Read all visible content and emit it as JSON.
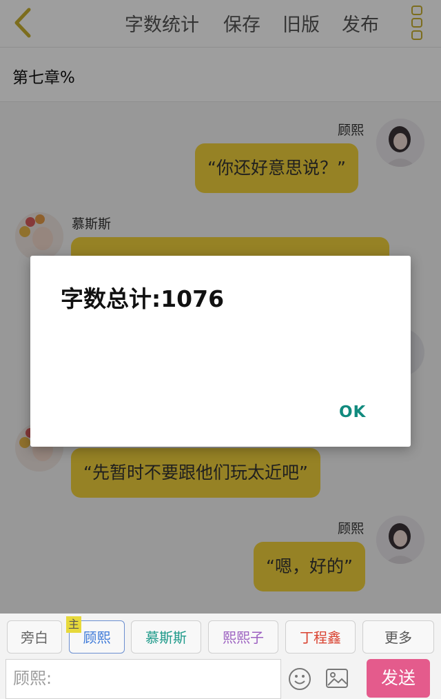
{
  "toolbar": {
    "back_icon": "chevron-left-icon",
    "word_count": "字数统计",
    "save": "保存",
    "old_version": "旧版",
    "publish": "发布",
    "more_icon": "more-vertical-icon",
    "accent_color": "#c9b030"
  },
  "chapter": {
    "title": "第七章%"
  },
  "messages": [
    {
      "speaker": "顾熙",
      "side": "right",
      "text": "“你还好意思说？”"
    },
    {
      "speaker": "慕斯斯",
      "side": "left",
      "text": ""
    },
    {
      "speaker": "",
      "side": "left",
      "text": "“先暂时不要跟他们玩太近吧”"
    },
    {
      "speaker": "顾熙",
      "side": "right",
      "text": "“嗯，好的”"
    }
  ],
  "bubble_color": "#f3d23c",
  "dialog": {
    "message": "字数总计:1076",
    "ok": "OK",
    "ok_color": "#118a7e"
  },
  "characters": {
    "main_tag": "主",
    "items": [
      {
        "label": "旁白",
        "color": "#666666"
      },
      {
        "label": "顾熙",
        "color": "#3b78d8"
      },
      {
        "label": "慕斯斯",
        "color": "#1f9a8a"
      },
      {
        "label": "熙熙子",
        "color": "#9b5fc0"
      },
      {
        "label": "丁程鑫",
        "color": "#d9412f"
      }
    ],
    "more": "更多"
  },
  "composer": {
    "placeholder": "顾熙:",
    "emoji_icon": "smiley-icon",
    "image_icon": "image-icon",
    "send": "发送",
    "send_color": "#e45b8c"
  }
}
